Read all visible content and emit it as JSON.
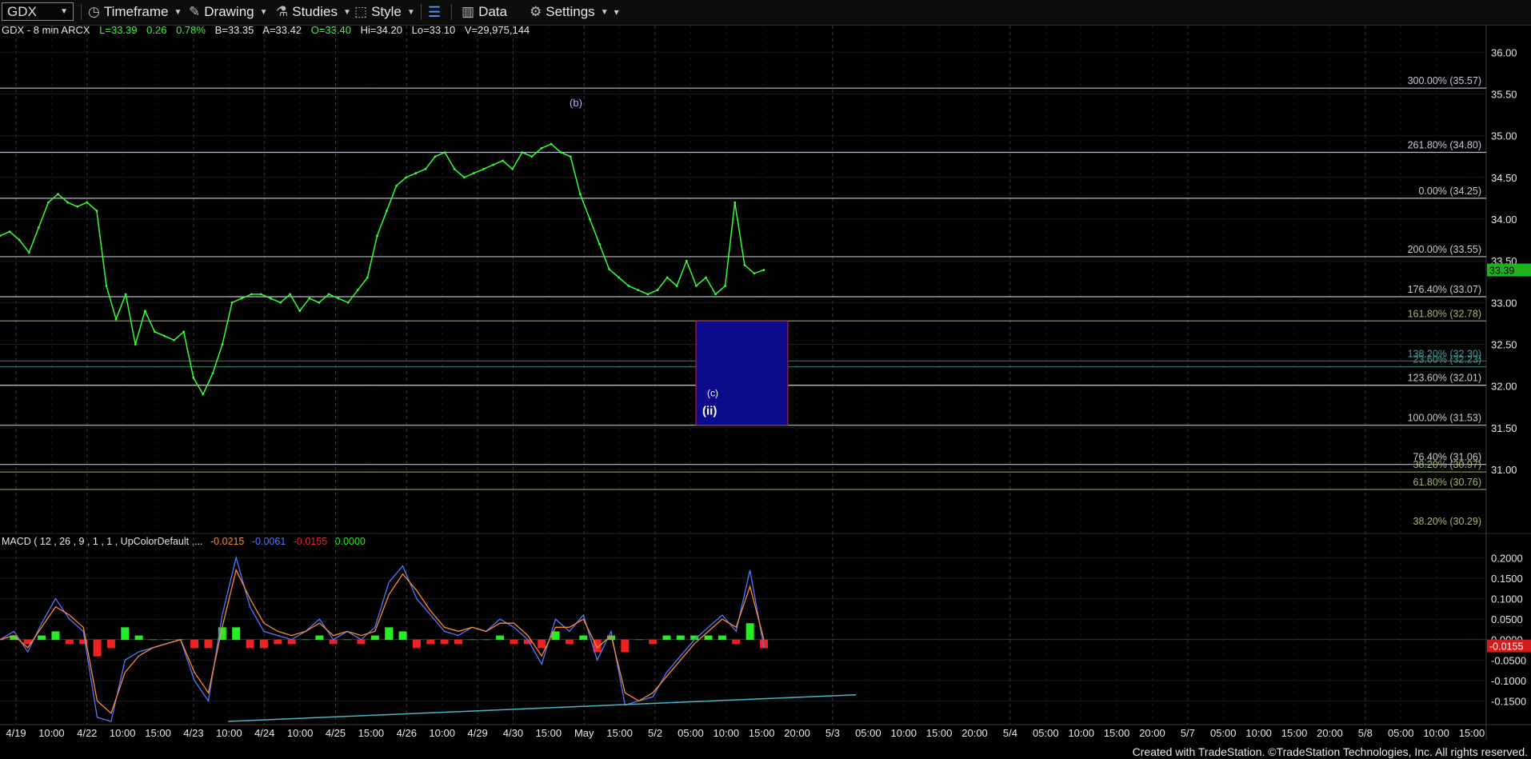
{
  "toolbar": {
    "symbol": "GDX",
    "timeframe_label": "Timeframe",
    "drawing_label": "Drawing",
    "studies_label": "Studies",
    "style_label": "Style",
    "data_label": "Data",
    "settings_label": "Settings"
  },
  "header": {
    "symbol_line": "GDX - 8 min  ARCX",
    "last": "L=33.39",
    "change": "0.26",
    "change_pct": "0.78%",
    "bid": "B=33.35",
    "ask": "A=33.42",
    "open": "O=33.40",
    "high": "Hi=34.20",
    "low": "Lo=33.10",
    "volume": "V=29,975,144"
  },
  "macd_header": {
    "label": "MACD ( 12 , 26 , 9 , 1 , 1 , UpColorDefault ,...",
    "v1": "-0.0215",
    "v2": "-0.0061",
    "v3": "-0.0155",
    "v4": "0.0000"
  },
  "footer": {
    "text": "Created with TradeStation. ©TradeStation Technologies, Inc. All rights reserved."
  },
  "colors": {
    "price": "#34ff34",
    "fib_line": "#b8bccc",
    "fib_label": "#c8cad4",
    "fib_gold": "#8a8a55",
    "fib_teal": "#2a6e6e",
    "box_fill": "#0b0b8c",
    "box_border": "#d22",
    "macd_line": "#5577ff",
    "signal_line": "#ff8a33",
    "hist_pos": "#22ee22",
    "hist_neg": "#ee2222",
    "trendline": "#49b6c6",
    "badge_bg": "#1db31d",
    "macd_badge_bg": "#d21c1c"
  },
  "chart_data": [
    {
      "type": "line",
      "title": "GDX - 8 min  ARCX",
      "ylim": [
        30.3,
        36.3
      ],
      "y_ticks": [
        "36.00",
        "35.50",
        "35.00",
        "34.50",
        "34.00",
        "33.50",
        "33.00",
        "32.50",
        "32.00",
        "31.50",
        "31.00"
      ],
      "x_tick_labels": [
        "4/19",
        "10:00",
        "4/22",
        "10:00",
        "15:00",
        "4/23",
        "10:00",
        "4/24",
        "10:00",
        "4/25",
        "15:00",
        "4/26",
        "10:00",
        "4/29",
        "4/30",
        "15:00",
        "May",
        "15:00",
        "5/2",
        "05:00",
        "10:00",
        "15:00",
        "20:00",
        "5/3",
        "05:00",
        "10:00",
        "15:00",
        "20:00",
        "5/4",
        "05:00",
        "10:00",
        "15:00",
        "20:00",
        "5/7",
        "05:00",
        "10:00",
        "15:00",
        "20:00",
        "5/8",
        "05:00",
        "10:00",
        "15:00"
      ],
      "last_price": "33.39",
      "series": [
        {
          "values": [
            33.8,
            33.85,
            33.75,
            33.6,
            33.9,
            34.2,
            34.3,
            34.2,
            34.15,
            34.2,
            34.1,
            33.2,
            32.8,
            33.1,
            32.5,
            32.9,
            32.65,
            32.6,
            32.55,
            32.65,
            32.1,
            31.9,
            32.15,
            32.5,
            33.0,
            33.05,
            33.1,
            33.1,
            33.05,
            33.0,
            33.1,
            32.9,
            33.05,
            33.0,
            33.1,
            33.05,
            33.0,
            33.15,
            33.3,
            33.8,
            34.1,
            34.4,
            34.5,
            34.55,
            34.6,
            34.75,
            34.8,
            34.6,
            34.5,
            34.55,
            34.6,
            34.65,
            34.7,
            34.6,
            34.8,
            34.75,
            34.85,
            34.9,
            34.8,
            34.75,
            34.3,
            34.0,
            33.7,
            33.4,
            33.3,
            33.2,
            33.15,
            33.1,
            33.15,
            33.3,
            33.2,
            33.5,
            33.2,
            33.3,
            33.1,
            33.2,
            34.2,
            33.45,
            33.35,
            33.39
          ]
        }
      ],
      "fib_levels": [
        {
          "label": "300.00% (35.57)",
          "value": 35.57
        },
        {
          "label": "261.80% (34.80)",
          "value": 34.8
        },
        {
          "label": "0.00% (34.25)",
          "value": 34.25
        },
        {
          "label": "200.00% (33.55)",
          "value": 33.55
        },
        {
          "label": "176.40% (33.07)",
          "value": 33.07
        },
        {
          "label": "161.80% (32.78)",
          "value": 32.78
        },
        {
          "label": "138.20% (32.30)",
          "value": 32.3
        },
        {
          "label": "23.60% (32.23)",
          "value": 32.23
        },
        {
          "label": "123.60% (32.01)",
          "value": 32.01
        },
        {
          "label": "100.00% (31.53)",
          "value": 31.53
        },
        {
          "label": "76.40% (31.06)",
          "value": 31.06
        },
        {
          "label": "38.20% (30.97)",
          "value": 30.97
        },
        {
          "label": "61.80% (30.76)",
          "value": 30.76
        },
        {
          "label": "38.20% (30.29)",
          "value": 30.29
        }
      ],
      "target_box": {
        "top": 32.78,
        "bottom": 31.53
      },
      "annotations": [
        "(b)",
        "(c)",
        "(ii)"
      ]
    },
    {
      "type": "line",
      "title": "MACD ( 12 , 26 , 9 , 1 , 1 , UpColorDefault ,...",
      "ylim": [
        -0.2,
        0.23
      ],
      "y_ticks": [
        "0.2000",
        "0.1500",
        "0.1000",
        "0.0500",
        "0.0000",
        "-0.0500",
        "-0.1000",
        "-0.1500"
      ],
      "last_value": "-0.0155",
      "series": [
        {
          "name": "MACD",
          "values": [
            0.0,
            0.02,
            -0.03,
            0.04,
            0.1,
            0.05,
            0.02,
            -0.19,
            -0.2,
            -0.05,
            -0.03,
            -0.02,
            -0.01,
            0.0,
            -0.1,
            -0.15,
            0.06,
            0.2,
            0.08,
            0.02,
            0.01,
            0.0,
            0.02,
            0.05,
            0.0,
            0.02,
            0.0,
            0.03,
            0.14,
            0.18,
            0.1,
            0.06,
            0.02,
            0.01,
            0.03,
            0.02,
            0.05,
            0.03,
            0.0,
            -0.06,
            0.05,
            0.02,
            0.06,
            -0.05,
            0.02,
            -0.16,
            -0.15,
            -0.14,
            -0.08,
            -0.04,
            0.0,
            0.03,
            0.06,
            0.02,
            0.17,
            -0.02
          ]
        },
        {
          "name": "Signal",
          "values": [
            0.0,
            0.01,
            -0.02,
            0.03,
            0.08,
            0.06,
            0.03,
            -0.15,
            -0.18,
            -0.08,
            -0.04,
            -0.02,
            -0.01,
            0.0,
            -0.08,
            -0.13,
            0.03,
            0.17,
            0.1,
            0.04,
            0.02,
            0.01,
            0.02,
            0.04,
            0.01,
            0.02,
            0.01,
            0.02,
            0.11,
            0.16,
            0.12,
            0.07,
            0.03,
            0.02,
            0.03,
            0.02,
            0.04,
            0.04,
            0.01,
            -0.04,
            0.03,
            0.03,
            0.05,
            -0.02,
            0.01,
            -0.13,
            -0.15,
            -0.13,
            -0.09,
            -0.05,
            -0.01,
            0.02,
            0.05,
            0.03,
            0.13,
            0.0
          ]
        }
      ],
      "histogram": [
        0.0,
        0.01,
        -0.01,
        0.01,
        0.02,
        -0.01,
        -0.01,
        -0.04,
        -0.02,
        0.03,
        0.01,
        0.0,
        0.0,
        0.0,
        -0.02,
        -0.02,
        0.03,
        0.03,
        -0.02,
        -0.02,
        -0.01,
        -0.01,
        0.0,
        0.01,
        -0.01,
        0.0,
        -0.01,
        0.01,
        0.03,
        0.02,
        -0.02,
        -0.01,
        -0.01,
        -0.01,
        0.0,
        0.0,
        0.01,
        -0.01,
        -0.01,
        -0.02,
        0.02,
        -0.01,
        0.01,
        -0.03,
        0.01,
        -0.03,
        0.0,
        -0.01,
        0.01,
        0.01,
        0.01,
        0.01,
        0.01,
        -0.01,
        0.04,
        -0.02
      ]
    }
  ]
}
